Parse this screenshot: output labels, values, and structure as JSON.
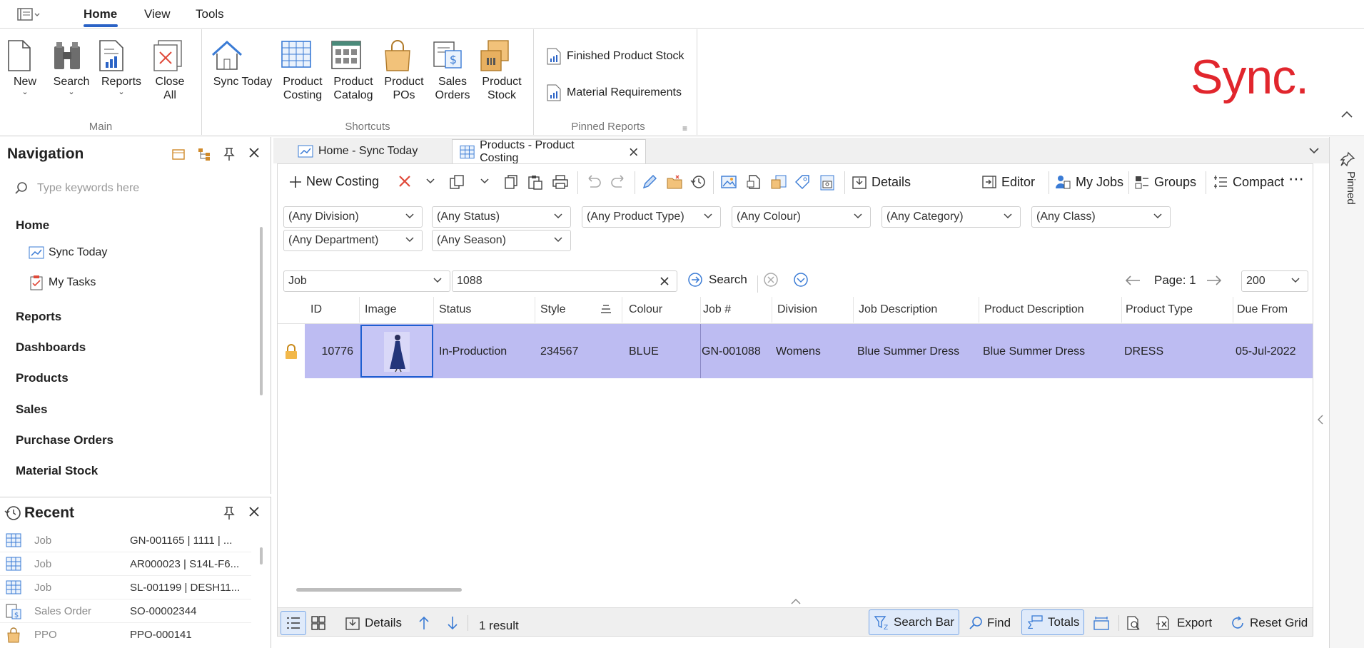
{
  "menu": {
    "tabs": [
      "Home",
      "View",
      "Tools"
    ]
  },
  "ribbon": {
    "main": {
      "label": "Main",
      "new": "New",
      "search": "Search",
      "reports": "Reports",
      "close_all_1": "Close",
      "close_all_2": "All"
    },
    "shortcuts": {
      "label": "Shortcuts",
      "sync_today": "Sync Today",
      "product_costing_1": "Product",
      "product_costing_2": "Costing",
      "product_catalog_1": "Product",
      "product_catalog_2": "Catalog",
      "product_pos_1": "Product",
      "product_pos_2": "POs",
      "sales_orders_1": "Sales",
      "sales_orders_2": "Orders",
      "product_stock_1": "Product",
      "product_stock_2": "Stock"
    },
    "pinned": {
      "label": "Pinned Reports",
      "item1": "Finished Product Stock",
      "item2": "Material Requirements"
    }
  },
  "logo": "Sync.",
  "navigation": {
    "title": "Navigation",
    "search_placeholder": "Type keywords here",
    "home": "Home",
    "sync_today": "Sync Today",
    "my_tasks": "My Tasks",
    "sections": [
      "Reports",
      "Dashboards",
      "Products",
      "Sales",
      "Purchase Orders",
      "Material Stock"
    ]
  },
  "recent": {
    "title": "Recent",
    "rows": [
      {
        "type": "Job",
        "value": "GN-001165 | 1111 | ..."
      },
      {
        "type": "Job",
        "value": "AR000023 | S14L-F6..."
      },
      {
        "type": "Job",
        "value": "SL-001199 | DESH11..."
      },
      {
        "type": "Sales Order",
        "value": "SO-00002344"
      },
      {
        "type": "PPO",
        "value": "PPO-000141"
      }
    ]
  },
  "doc_tabs": {
    "tab1": "Home - Sync Today",
    "tab2": "Products - Product Costing"
  },
  "toolbar": {
    "new_costing": "New Costing",
    "details": "Details",
    "editor": "Editor",
    "my_jobs": "My Jobs",
    "groups": "Groups",
    "compact": "Compact"
  },
  "filters": {
    "division": "(Any Division)",
    "status": "(Any Status)",
    "product_type": "(Any Product Type)",
    "colour": "(Any Colour)",
    "category": "(Any Category)",
    "class": "(Any Class)",
    "department": "(Any Department)",
    "season": "(Any Season)"
  },
  "search": {
    "field": "Job",
    "value": "1088",
    "button": "Search",
    "page": "Page: 1",
    "page_size": "200"
  },
  "grid": {
    "columns": [
      "ID",
      "Image",
      "Status",
      "Style",
      "Colour",
      "Job #",
      "Division",
      "Job Description",
      "Product Description",
      "Product Type",
      "Due From"
    ],
    "row": {
      "id": "10776",
      "status": "In-Production",
      "style": "234567",
      "colour": "BLUE",
      "job": "GN-001088",
      "division": "Womens",
      "job_description": "Blue Summer Dress",
      "product_description": "Blue Summer Dress",
      "product_type": "DRESS",
      "due_from": "05-Jul-2022"
    }
  },
  "statusbar": {
    "details": "Details",
    "result": "1 result",
    "search_bar": "Search Bar",
    "find": "Find",
    "totals": "Totals",
    "export": "Export",
    "reset_grid": "Reset Grid"
  },
  "rail": {
    "pinned": "Pinned"
  }
}
